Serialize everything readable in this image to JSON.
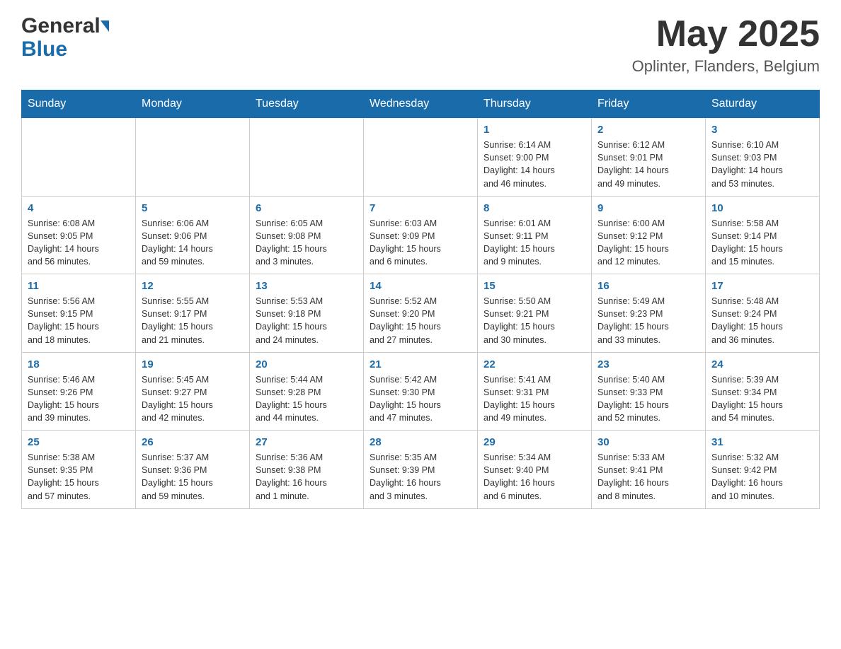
{
  "header": {
    "logo_general": "General",
    "logo_blue": "Blue",
    "month_year": "May 2025",
    "location": "Oplinter, Flanders, Belgium"
  },
  "days_of_week": [
    "Sunday",
    "Monday",
    "Tuesday",
    "Wednesday",
    "Thursday",
    "Friday",
    "Saturday"
  ],
  "weeks": [
    {
      "days": [
        {
          "number": "",
          "info": ""
        },
        {
          "number": "",
          "info": ""
        },
        {
          "number": "",
          "info": ""
        },
        {
          "number": "",
          "info": ""
        },
        {
          "number": "1",
          "info": "Sunrise: 6:14 AM\nSunset: 9:00 PM\nDaylight: 14 hours\nand 46 minutes."
        },
        {
          "number": "2",
          "info": "Sunrise: 6:12 AM\nSunset: 9:01 PM\nDaylight: 14 hours\nand 49 minutes."
        },
        {
          "number": "3",
          "info": "Sunrise: 6:10 AM\nSunset: 9:03 PM\nDaylight: 14 hours\nand 53 minutes."
        }
      ]
    },
    {
      "days": [
        {
          "number": "4",
          "info": "Sunrise: 6:08 AM\nSunset: 9:05 PM\nDaylight: 14 hours\nand 56 minutes."
        },
        {
          "number": "5",
          "info": "Sunrise: 6:06 AM\nSunset: 9:06 PM\nDaylight: 14 hours\nand 59 minutes."
        },
        {
          "number": "6",
          "info": "Sunrise: 6:05 AM\nSunset: 9:08 PM\nDaylight: 15 hours\nand 3 minutes."
        },
        {
          "number": "7",
          "info": "Sunrise: 6:03 AM\nSunset: 9:09 PM\nDaylight: 15 hours\nand 6 minutes."
        },
        {
          "number": "8",
          "info": "Sunrise: 6:01 AM\nSunset: 9:11 PM\nDaylight: 15 hours\nand 9 minutes."
        },
        {
          "number": "9",
          "info": "Sunrise: 6:00 AM\nSunset: 9:12 PM\nDaylight: 15 hours\nand 12 minutes."
        },
        {
          "number": "10",
          "info": "Sunrise: 5:58 AM\nSunset: 9:14 PM\nDaylight: 15 hours\nand 15 minutes."
        }
      ]
    },
    {
      "days": [
        {
          "number": "11",
          "info": "Sunrise: 5:56 AM\nSunset: 9:15 PM\nDaylight: 15 hours\nand 18 minutes."
        },
        {
          "number": "12",
          "info": "Sunrise: 5:55 AM\nSunset: 9:17 PM\nDaylight: 15 hours\nand 21 minutes."
        },
        {
          "number": "13",
          "info": "Sunrise: 5:53 AM\nSunset: 9:18 PM\nDaylight: 15 hours\nand 24 minutes."
        },
        {
          "number": "14",
          "info": "Sunrise: 5:52 AM\nSunset: 9:20 PM\nDaylight: 15 hours\nand 27 minutes."
        },
        {
          "number": "15",
          "info": "Sunrise: 5:50 AM\nSunset: 9:21 PM\nDaylight: 15 hours\nand 30 minutes."
        },
        {
          "number": "16",
          "info": "Sunrise: 5:49 AM\nSunset: 9:23 PM\nDaylight: 15 hours\nand 33 minutes."
        },
        {
          "number": "17",
          "info": "Sunrise: 5:48 AM\nSunset: 9:24 PM\nDaylight: 15 hours\nand 36 minutes."
        }
      ]
    },
    {
      "days": [
        {
          "number": "18",
          "info": "Sunrise: 5:46 AM\nSunset: 9:26 PM\nDaylight: 15 hours\nand 39 minutes."
        },
        {
          "number": "19",
          "info": "Sunrise: 5:45 AM\nSunset: 9:27 PM\nDaylight: 15 hours\nand 42 minutes."
        },
        {
          "number": "20",
          "info": "Sunrise: 5:44 AM\nSunset: 9:28 PM\nDaylight: 15 hours\nand 44 minutes."
        },
        {
          "number": "21",
          "info": "Sunrise: 5:42 AM\nSunset: 9:30 PM\nDaylight: 15 hours\nand 47 minutes."
        },
        {
          "number": "22",
          "info": "Sunrise: 5:41 AM\nSunset: 9:31 PM\nDaylight: 15 hours\nand 49 minutes."
        },
        {
          "number": "23",
          "info": "Sunrise: 5:40 AM\nSunset: 9:33 PM\nDaylight: 15 hours\nand 52 minutes."
        },
        {
          "number": "24",
          "info": "Sunrise: 5:39 AM\nSunset: 9:34 PM\nDaylight: 15 hours\nand 54 minutes."
        }
      ]
    },
    {
      "days": [
        {
          "number": "25",
          "info": "Sunrise: 5:38 AM\nSunset: 9:35 PM\nDaylight: 15 hours\nand 57 minutes."
        },
        {
          "number": "26",
          "info": "Sunrise: 5:37 AM\nSunset: 9:36 PM\nDaylight: 15 hours\nand 59 minutes."
        },
        {
          "number": "27",
          "info": "Sunrise: 5:36 AM\nSunset: 9:38 PM\nDaylight: 16 hours\nand 1 minute."
        },
        {
          "number": "28",
          "info": "Sunrise: 5:35 AM\nSunset: 9:39 PM\nDaylight: 16 hours\nand 3 minutes."
        },
        {
          "number": "29",
          "info": "Sunrise: 5:34 AM\nSunset: 9:40 PM\nDaylight: 16 hours\nand 6 minutes."
        },
        {
          "number": "30",
          "info": "Sunrise: 5:33 AM\nSunset: 9:41 PM\nDaylight: 16 hours\nand 8 minutes."
        },
        {
          "number": "31",
          "info": "Sunrise: 5:32 AM\nSunset: 9:42 PM\nDaylight: 16 hours\nand 10 minutes."
        }
      ]
    }
  ]
}
